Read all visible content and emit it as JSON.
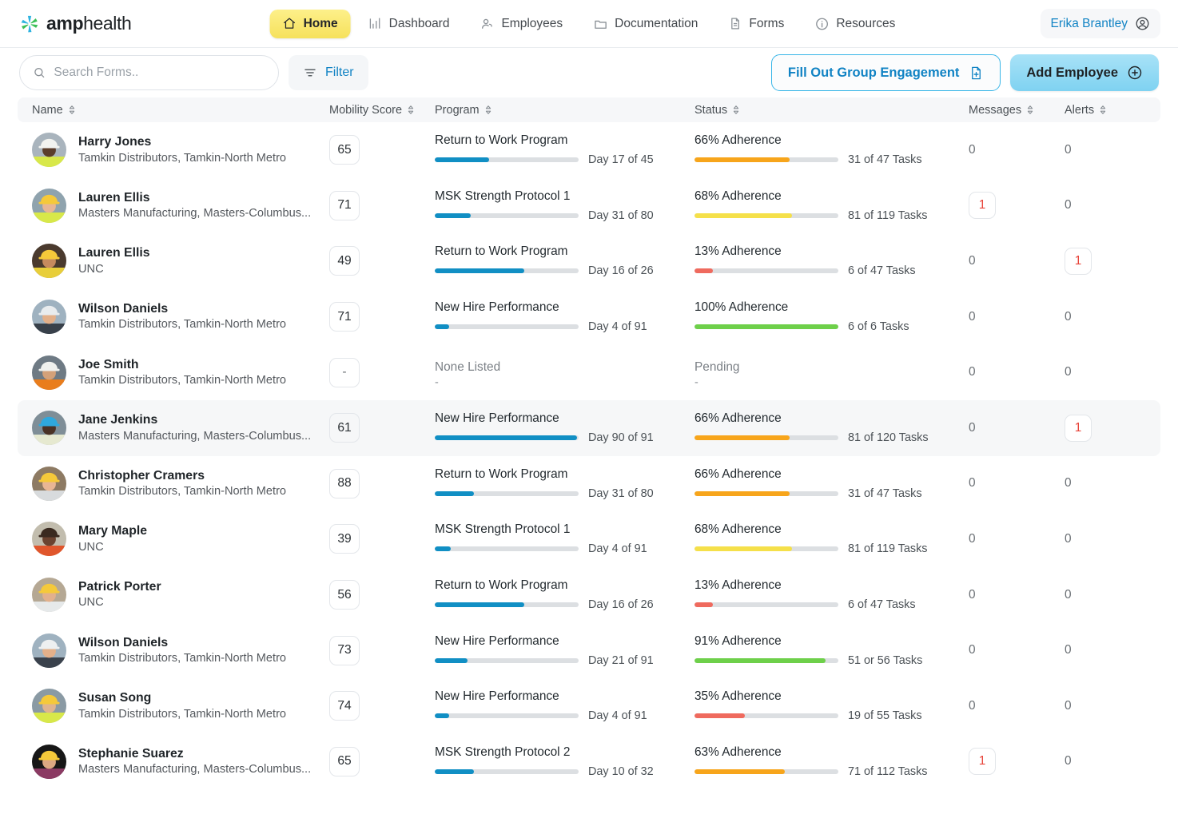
{
  "brand": {
    "name_bold": "amp",
    "name_light": "health",
    "logo_icon": "pinwheel-logo-icon"
  },
  "nav": {
    "items": [
      {
        "label": "Home",
        "icon": "home-icon",
        "active": true
      },
      {
        "label": "Dashboard",
        "icon": "bar-chart-icon",
        "active": false
      },
      {
        "label": "Employees",
        "icon": "people-icon",
        "active": false
      },
      {
        "label": "Documentation",
        "icon": "folder-icon",
        "active": false
      },
      {
        "label": "Forms",
        "icon": "document-icon",
        "active": false
      },
      {
        "label": "Resources",
        "icon": "info-circle-icon",
        "active": false
      }
    ],
    "user": {
      "name": "Erika Brantley",
      "icon": "user-circle-icon"
    }
  },
  "toolbar": {
    "search_placeholder": "Search Forms..",
    "search_value": "",
    "search_icon": "search-icon",
    "filter_label": "Filter",
    "filter_icon": "filter-icon",
    "group_engagement_label": "Fill Out Group Engagement",
    "group_engagement_icon": "document-plus-icon",
    "add_employee_label": "Add Employee",
    "add_employee_icon": "plus-circle-icon"
  },
  "table": {
    "headers": [
      {
        "label": "Name",
        "sortable": true
      },
      {
        "label": "Mobility Score",
        "sortable": true
      },
      {
        "label": "Program",
        "sortable": true
      },
      {
        "label": "Status",
        "sortable": true
      },
      {
        "label": "Messages",
        "sortable": true
      },
      {
        "label": "Alerts",
        "sortable": true
      }
    ],
    "rows": [
      {
        "name": "Harry Jones",
        "org": "Tamkin Distributors, Tamkin-North Metro",
        "score": "65",
        "program": "Return to Work Program",
        "program_day_label": "Day 17 of 45",
        "program_pct": 38,
        "status": "66% Adherence",
        "status_tasks": "31 of 47 Tasks",
        "status_pct": 66,
        "status_color": "#f7a51b",
        "messages": "0",
        "alerts": "0",
        "messages_alert": false,
        "alerts_alert": false,
        "highlight": false,
        "avatar_bg": "#a9b4bd",
        "avatar_hat": "#f2f3f0",
        "avatar_skin": "#5b3d2b",
        "avatar_vest": "#d8e84a"
      },
      {
        "name": "Lauren Ellis",
        "org": "Masters Manufacturing, Masters-Columbus...",
        "score": "71",
        "program": "MSK Strength Protocol 1",
        "program_day_label": "Day 31 of 80",
        "program_pct": 25,
        "status": "68% Adherence",
        "status_tasks": "81 of 119 Tasks",
        "status_pct": 68,
        "status_color": "#f5e04a",
        "messages": "1",
        "alerts": "0",
        "messages_alert": true,
        "alerts_alert": false,
        "highlight": false,
        "avatar_bg": "#8fa3ae",
        "avatar_hat": "#f5c93a",
        "avatar_skin": "#e8b694",
        "avatar_vest": "#d8e84a"
      },
      {
        "name": "Lauren Ellis",
        "org": "UNC",
        "score": "49",
        "program": "Return to Work Program",
        "program_day_label": "Day 16 of 26",
        "program_pct": 62,
        "status": "13% Adherence",
        "status_tasks": "6 of 47 Tasks",
        "status_pct": 13,
        "status_color": "#ef6a5e",
        "messages": "0",
        "alerts": "1",
        "messages_alert": false,
        "alerts_alert": true,
        "highlight": false,
        "avatar_bg": "#4a3a2e",
        "avatar_hat": "#f5c93a",
        "avatar_skin": "#c68a5e",
        "avatar_vest": "#e8ce3a"
      },
      {
        "name": "Wilson Daniels",
        "org": "Tamkin Distributors, Tamkin-North Metro",
        "score": "71",
        "program": "New Hire Performance",
        "program_day_label": "Day 4 of 91",
        "program_pct": 10,
        "status": "100% Adherence",
        "status_tasks": "6 of 6 Tasks",
        "status_pct": 100,
        "status_color": "#6ed04a",
        "messages": "0",
        "alerts": "0",
        "messages_alert": false,
        "alerts_alert": false,
        "highlight": false,
        "avatar_bg": "#9fb2c0",
        "avatar_hat": "#e9ecee",
        "avatar_skin": "#e3b08a",
        "avatar_vest": "#38404a"
      },
      {
        "name": "Joe Smith",
        "org": "Tamkin Distributors, Tamkin-North Metro",
        "score": "-",
        "program": "None Listed",
        "program_day_label": "-",
        "program_pct": null,
        "status": "Pending",
        "status_tasks": "-",
        "status_pct": null,
        "status_color": "",
        "messages": "0",
        "alerts": "0",
        "messages_alert": false,
        "alerts_alert": false,
        "highlight": false,
        "avatar_bg": "#6e7a84",
        "avatar_hat": "#f0f1ee",
        "avatar_skin": "#d4a179",
        "avatar_vest": "#e97d1c"
      },
      {
        "name": "Jane Jenkins",
        "org": "Masters Manufacturing, Masters-Columbus...",
        "score": "61",
        "program": "New Hire Performance",
        "program_day_label": "Day 90 of 91",
        "program_pct": 99,
        "status": "66% Adherence",
        "status_tasks": "81 of 120 Tasks",
        "status_pct": 66,
        "status_color": "#f7a51b",
        "messages": "0",
        "alerts": "1",
        "messages_alert": false,
        "alerts_alert": true,
        "highlight": true,
        "avatar_bg": "#7f8e97",
        "avatar_hat": "#2fa8dd",
        "avatar_skin": "#4a3226",
        "avatar_vest": "#e6e9d0"
      },
      {
        "name": "Christopher Cramers",
        "org": "Tamkin Distributors, Tamkin-North Metro",
        "score": "88",
        "program": "Return to Work Program",
        "program_day_label": "Day 31 of 80",
        "program_pct": 27,
        "status": "66% Adherence",
        "status_tasks": "31 of 47 Tasks",
        "status_pct": 66,
        "status_color": "#f7a51b",
        "messages": "0",
        "alerts": "0",
        "messages_alert": false,
        "alerts_alert": false,
        "highlight": false,
        "avatar_bg": "#8d7a63",
        "avatar_hat": "#f5c93a",
        "avatar_skin": "#e8b694",
        "avatar_vest": "#d8dbdd"
      },
      {
        "name": "Mary Maple",
        "org": "UNC",
        "score": "39",
        "program": "MSK Strength Protocol 1",
        "program_day_label": "Day 4 of 91",
        "program_pct": 11,
        "status": "68% Adherence",
        "status_tasks": "81 of 119 Tasks",
        "status_pct": 68,
        "status_color": "#f5e04a",
        "messages": "0",
        "alerts": "0",
        "messages_alert": false,
        "alerts_alert": false,
        "highlight": false,
        "avatar_bg": "#c2bdae",
        "avatar_hat": "#3a2a20",
        "avatar_skin": "#6b4330",
        "avatar_vest": "#e0562c"
      },
      {
        "name": "Patrick Porter",
        "org": "UNC",
        "score": "56",
        "program": "Return to Work Program",
        "program_day_label": "Day 16 of 26",
        "program_pct": 62,
        "status": "13% Adherence",
        "status_tasks": "6 of 47 Tasks",
        "status_pct": 13,
        "status_color": "#ef6a5e",
        "messages": "0",
        "alerts": "0",
        "messages_alert": false,
        "alerts_alert": false,
        "highlight": false,
        "avatar_bg": "#b5a894",
        "avatar_hat": "#f5c93a",
        "avatar_skin": "#e2b08c",
        "avatar_vest": "#e6e9ea"
      },
      {
        "name": "Wilson Daniels",
        "org": "Tamkin Distributors, Tamkin-North Metro",
        "score": "73",
        "program": "New Hire Performance",
        "program_day_label": "Day 21 of 91",
        "program_pct": 23,
        "status": "91% Adherence",
        "status_tasks": "51 or 56 Tasks",
        "status_pct": 91,
        "status_color": "#6ed04a",
        "messages": "0",
        "alerts": "0",
        "messages_alert": false,
        "alerts_alert": false,
        "highlight": false,
        "avatar_bg": "#9fb2c0",
        "avatar_hat": "#eef0f1",
        "avatar_skin": "#e3b08a",
        "avatar_vest": "#3a424c"
      },
      {
        "name": "Susan Song",
        "org": "Tamkin Distributors, Tamkin-North Metro",
        "score": "74",
        "program": "New Hire Performance",
        "program_day_label": "Day 4 of 91",
        "program_pct": 10,
        "status": "35% Adherence",
        "status_tasks": "19 of 55 Tasks",
        "status_pct": 35,
        "status_color": "#ef6a5e",
        "messages": "0",
        "alerts": "0",
        "messages_alert": false,
        "alerts_alert": false,
        "highlight": false,
        "avatar_bg": "#8a9aa4",
        "avatar_hat": "#f5c93a",
        "avatar_skin": "#e0b48e",
        "avatar_vest": "#d8e84a"
      },
      {
        "name": "Stephanie Suarez",
        "org": "Masters Manufacturing, Masters-Columbus...",
        "score": "65",
        "program": "MSK Strength Protocol 2",
        "program_day_label": "Day 10 of 32",
        "program_pct": 27,
        "status": "63% Adherence",
        "status_tasks": "71 of 112 Tasks",
        "status_pct": 63,
        "status_color": "#f7a51b",
        "messages": "1",
        "alerts": "0",
        "messages_alert": true,
        "alerts_alert": false,
        "highlight": false,
        "avatar_bg": "#171717",
        "avatar_hat": "#f5c93a",
        "avatar_skin": "#dba882",
        "avatar_vest": "#8b3a63"
      }
    ]
  },
  "colors": {
    "accent_blue": "#1183c4",
    "progress_blue": "#118fc4",
    "alert_red": "#e8443a",
    "track_gray": "#dcdfe2",
    "brand_yellow": "#f6e15c"
  }
}
